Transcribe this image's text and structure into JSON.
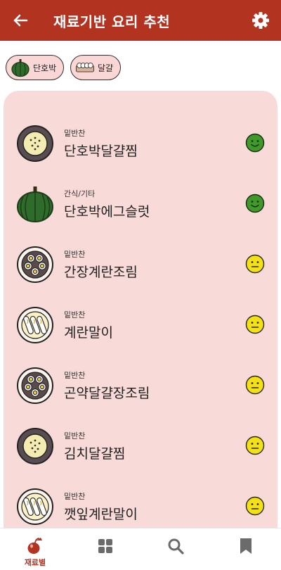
{
  "header": {
    "title": "재료기반 요리 추천"
  },
  "ingredients": [
    {
      "label": "단호박",
      "icon": "pumpkin-icon"
    },
    {
      "label": "달걀",
      "icon": "egg-carton-icon"
    }
  ],
  "recipes": [
    {
      "category": "밑반찬",
      "name": "단호박달걀찜",
      "thumb": "steamed-egg",
      "face": "happy"
    },
    {
      "category": "간식/기타",
      "name": "단호박에그슬럿",
      "thumb": "pumpkin",
      "face": "happy"
    },
    {
      "category": "밑반찬",
      "name": "간장계란조림",
      "thumb": "braised-eggs",
      "face": "neutral"
    },
    {
      "category": "밑반찬",
      "name": "계란말이",
      "thumb": "egg-roll",
      "face": "neutral"
    },
    {
      "category": "밑반찬",
      "name": "곤약달걀장조림",
      "thumb": "braised-eggs",
      "face": "neutral"
    },
    {
      "category": "밑반찬",
      "name": "김치달걀찜",
      "thumb": "steamed-egg",
      "face": "neutral"
    },
    {
      "category": "밑반찬",
      "name": "깻잎계란말이",
      "thumb": "egg-roll",
      "face": "neutral"
    }
  ],
  "nav": [
    {
      "label": "재료별",
      "icon": "ingredient-icon",
      "active": true
    },
    {
      "label": "",
      "icon": "category-grid-icon"
    },
    {
      "label": "",
      "icon": "search-icon"
    },
    {
      "label": "",
      "icon": "bookmark-icon"
    }
  ],
  "colors": {
    "appbar": "#b23320",
    "panel": "#f8dad8",
    "happy_face": "#3f9a2a",
    "neutral_face": "#f3e016"
  }
}
